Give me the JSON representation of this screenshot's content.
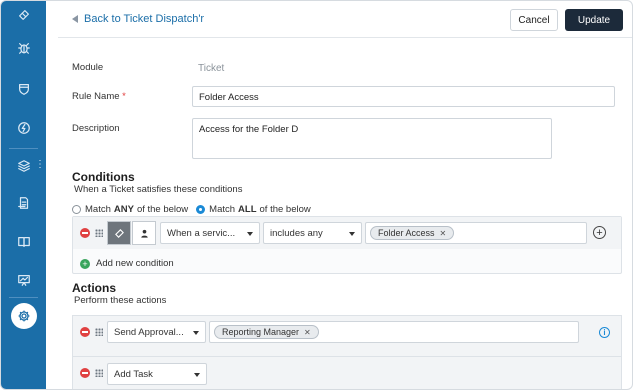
{
  "header": {
    "back_label": "Back to Ticket Dispatch'r",
    "cancel_label": "Cancel",
    "update_label": "Update"
  },
  "sidebar": {
    "items": [
      {
        "icon": "ticket-icon"
      },
      {
        "icon": "bug-icon"
      },
      {
        "icon": "shield-icon"
      },
      {
        "icon": "bolt-icon"
      },
      {
        "icon": "layers-icon"
      },
      {
        "icon": "document-icon"
      },
      {
        "icon": "book-icon"
      },
      {
        "icon": "chart-icon"
      },
      {
        "icon": "gear-icon",
        "active": true
      }
    ],
    "more_glyph": "⋮"
  },
  "form": {
    "module_label": "Module",
    "module_value": "Ticket",
    "rule_name_label": "Rule Name",
    "required_mark": "*",
    "rule_name_value": "Folder Access",
    "description_label": "Description",
    "description_value": "Access for the Folder D"
  },
  "conditions": {
    "title": "Conditions",
    "subtitle": "When a Ticket satisfies these conditions",
    "match_prefix": "Match",
    "match_any": "ANY",
    "match_all": "ALL",
    "match_suffix": "of the below",
    "selected_match": "ALL",
    "row": {
      "field": "When a servic...",
      "operator": "includes any",
      "tags": [
        "Folder Access"
      ]
    },
    "add_label": "Add new condition"
  },
  "actions": {
    "title": "Actions",
    "subtitle": "Perform these actions",
    "row": {
      "action": "Send Approval...",
      "tags": [
        "Reporting Manager"
      ]
    },
    "add_task_label": "Add Task"
  },
  "colors": {
    "sidebar": "#1b6ea8",
    "primary_button": "#1c2a3a",
    "link": "#1b6ea8",
    "remove": "#e04141",
    "add": "#3aa55d"
  }
}
